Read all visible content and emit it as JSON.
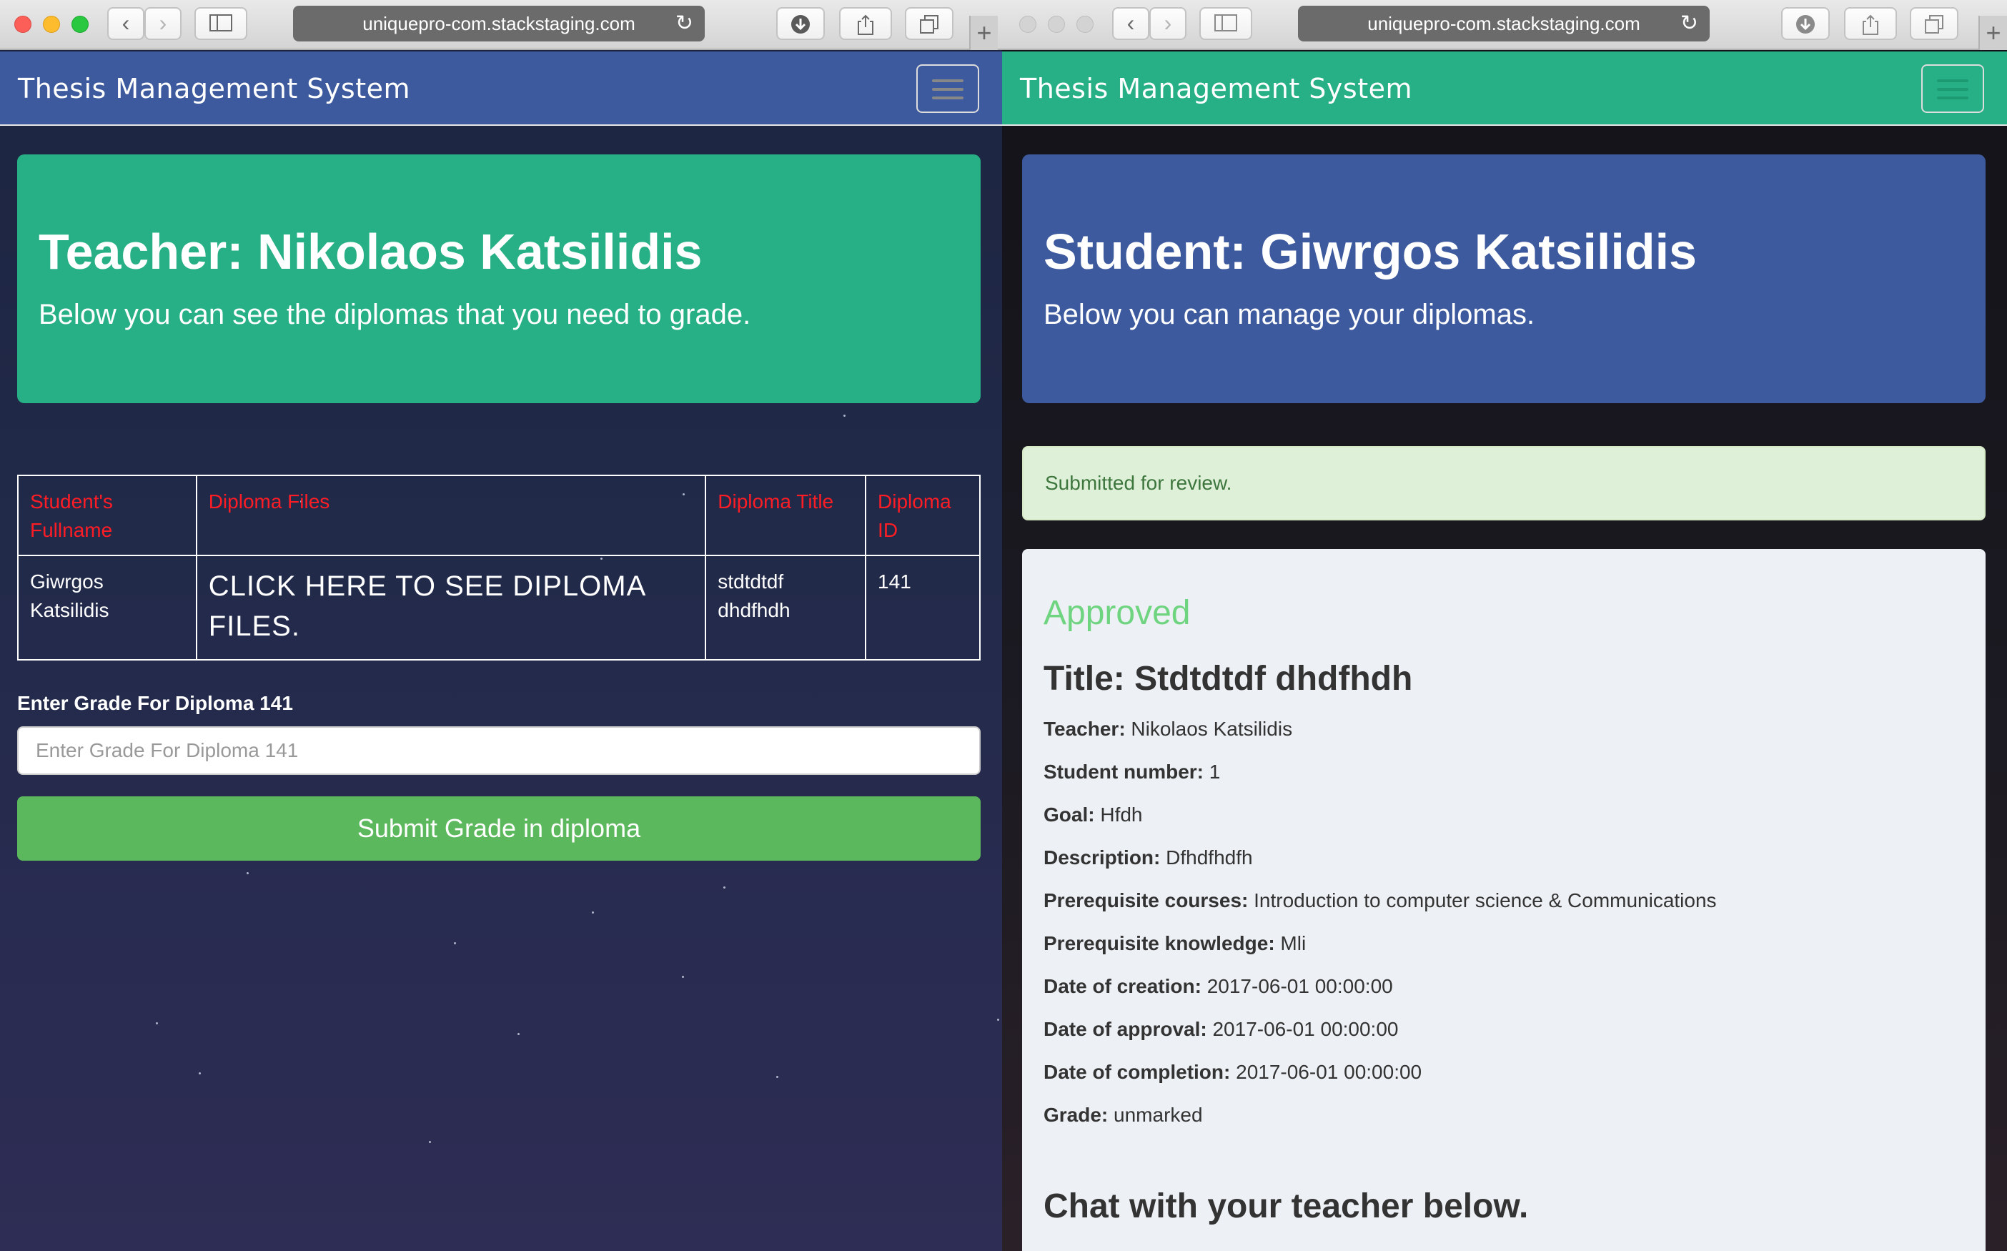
{
  "left_window": {
    "url": "uniquepro-com.stackstaging.com",
    "brand": "Thesis Management System",
    "navbar_color": "#3e5a9e",
    "jumbotron_color": "#27b085",
    "heading": "Teacher: Nikolaos Katsilidis",
    "subheading": "Below you can see the diplomas that you need to grade.",
    "table": {
      "headers": [
        "Student's Fullname",
        "Diploma Files",
        "Diploma Title",
        "Diploma ID"
      ],
      "rows": [
        [
          "Giwrgos Katsilidis",
          "CLICK HERE TO SEE DIPLOMA FILES.",
          "stdtdtdf dhdfhdh",
          "141"
        ]
      ]
    },
    "grade_label": "Enter Grade For Diploma 141",
    "grade_placeholder": "Enter Grade For Diploma 141",
    "submit_label": "Submit Grade in diploma",
    "submit_color": "#5cb85c"
  },
  "right_window": {
    "url": "uniquepro-com.stackstaging.com",
    "brand": "Thesis Management System",
    "navbar_color": "#27b085",
    "jumbotron_color": "#3e5a9e",
    "heading": "Student: Giwrgos Katsilidis",
    "subheading": "Below you can manage your diplomas.",
    "alert": "Submitted for review.",
    "status": "Approved",
    "title": "Title: Stdtdtdf dhdfhdh",
    "details": [
      {
        "label": "Teacher:",
        "value": "Nikolaos Katsilidis"
      },
      {
        "label": "Student number:",
        "value": "1"
      },
      {
        "label": "Goal:",
        "value": "Hfdh"
      },
      {
        "label": "Description:",
        "value": "Dfhdfhdfh"
      },
      {
        "label": "Prerequisite courses:",
        "value": "Introduction to computer science & Communications"
      },
      {
        "label": "Prerequisite knowledge:",
        "value": "Mli"
      },
      {
        "label": "Date of creation:",
        "value": "2017-06-01 00:00:00"
      },
      {
        "label": "Date of approval:",
        "value": "2017-06-01 00:00:00"
      },
      {
        "label": "Date of completion:",
        "value": "2017-06-01 00:00:00"
      },
      {
        "label": "Grade:",
        "value": "unmarked"
      }
    ],
    "chat_heading": "Chat with your teacher below."
  },
  "icons": [
    "back-icon",
    "forward-icon",
    "sidebar-icon",
    "download-icon",
    "share-icon",
    "tabs-icon",
    "reload-icon",
    "new-tab-icon",
    "hamburger-icon"
  ]
}
